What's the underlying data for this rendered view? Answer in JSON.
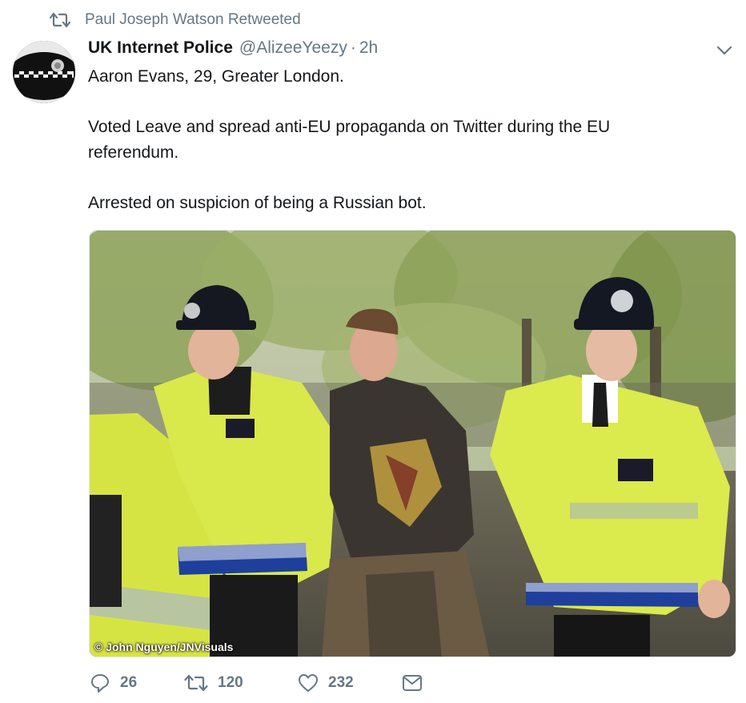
{
  "retweet_context": {
    "icon": "retweet-icon",
    "text": "Paul Joseph Watson Retweeted"
  },
  "tweet": {
    "avatar_icon": "police-hat-avatar",
    "display_name": "UK Internet Police",
    "handle": "@AlizeeYeezy",
    "separator": "·",
    "time": "2h",
    "menu_icon": "chevron-down-icon",
    "text_lines": {
      "line1": "Aaron Evans, 29, Greater London.",
      "line2": "Voted Leave and spread anti-EU propaganda on Twitter during the EU referendum.",
      "line3": "Arrested on suspicion of being a Russian bot."
    },
    "media": {
      "credit": "© John Nguyen/JNVisuals"
    },
    "actions": {
      "reply": {
        "icon": "reply-icon",
        "count": "26"
      },
      "retweet": {
        "icon": "retweet-icon",
        "count": "120"
      },
      "like": {
        "icon": "heart-icon",
        "count": "232"
      },
      "dm": {
        "icon": "envelope-icon"
      }
    }
  },
  "colors": {
    "text": "#14171a",
    "secondary": "#657786",
    "border": "#e1e8ed",
    "hi_vis": "#d8e84a"
  }
}
